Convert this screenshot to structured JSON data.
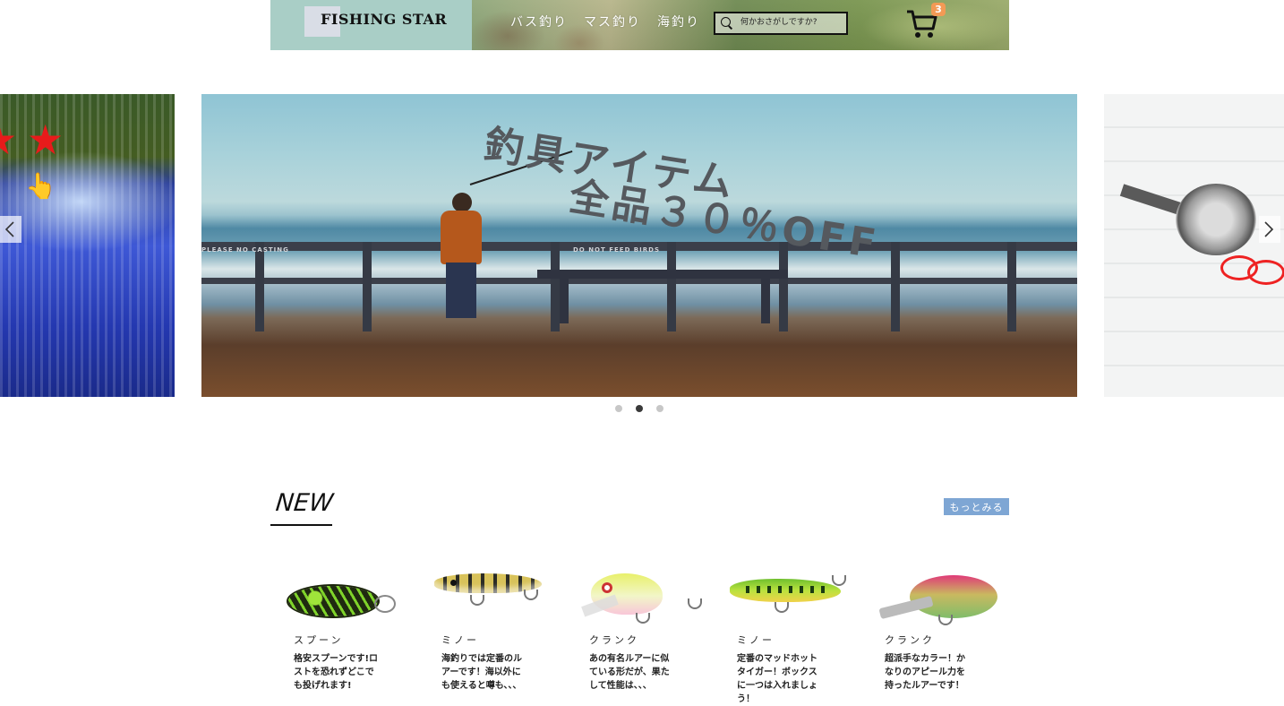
{
  "header": {
    "logo": "FISHING STAR",
    "nav": [
      "バス釣り",
      "マス釣り",
      "海釣り"
    ],
    "search_placeholder": "何かおさがしですか?",
    "cart_count": "3"
  },
  "carousel": {
    "main_slide": {
      "line1": "釣具アイテム",
      "line2": "全品３０％OFF",
      "sign_left": "PLEASE NO CASTING",
      "sign_center": "DO NOT FEED BIRDS"
    },
    "slide_count": 3,
    "active_index": 1
  },
  "new_section": {
    "title": "NEW",
    "more_label": "もっとみる",
    "products": [
      {
        "category": "スプーン",
        "description": "格安スプーンです!ロストを恐れずどこでも投げれます!"
      },
      {
        "category": "ミノー",
        "description": "海釣りでは定番のルアーです！海以外にも使えると噂も、、、"
      },
      {
        "category": "クランク",
        "description": "あの有名ルアーに似ている形だが、果たして性能は、、、"
      },
      {
        "category": "ミノー",
        "description": "定番のマッドホットタイガー！ボックスに一つは入れましょう！"
      },
      {
        "category": "クランク",
        "description": "超派手なカラー！かなりのアピール力を持ったルアーです！"
      }
    ]
  },
  "colors": {
    "header_left_bg": "#a9cec6",
    "badge": "#f39a55",
    "more_button": "#7ea6d4",
    "dot_active": "#3a3a3a",
    "dot_inactive": "#c7c7c7"
  }
}
